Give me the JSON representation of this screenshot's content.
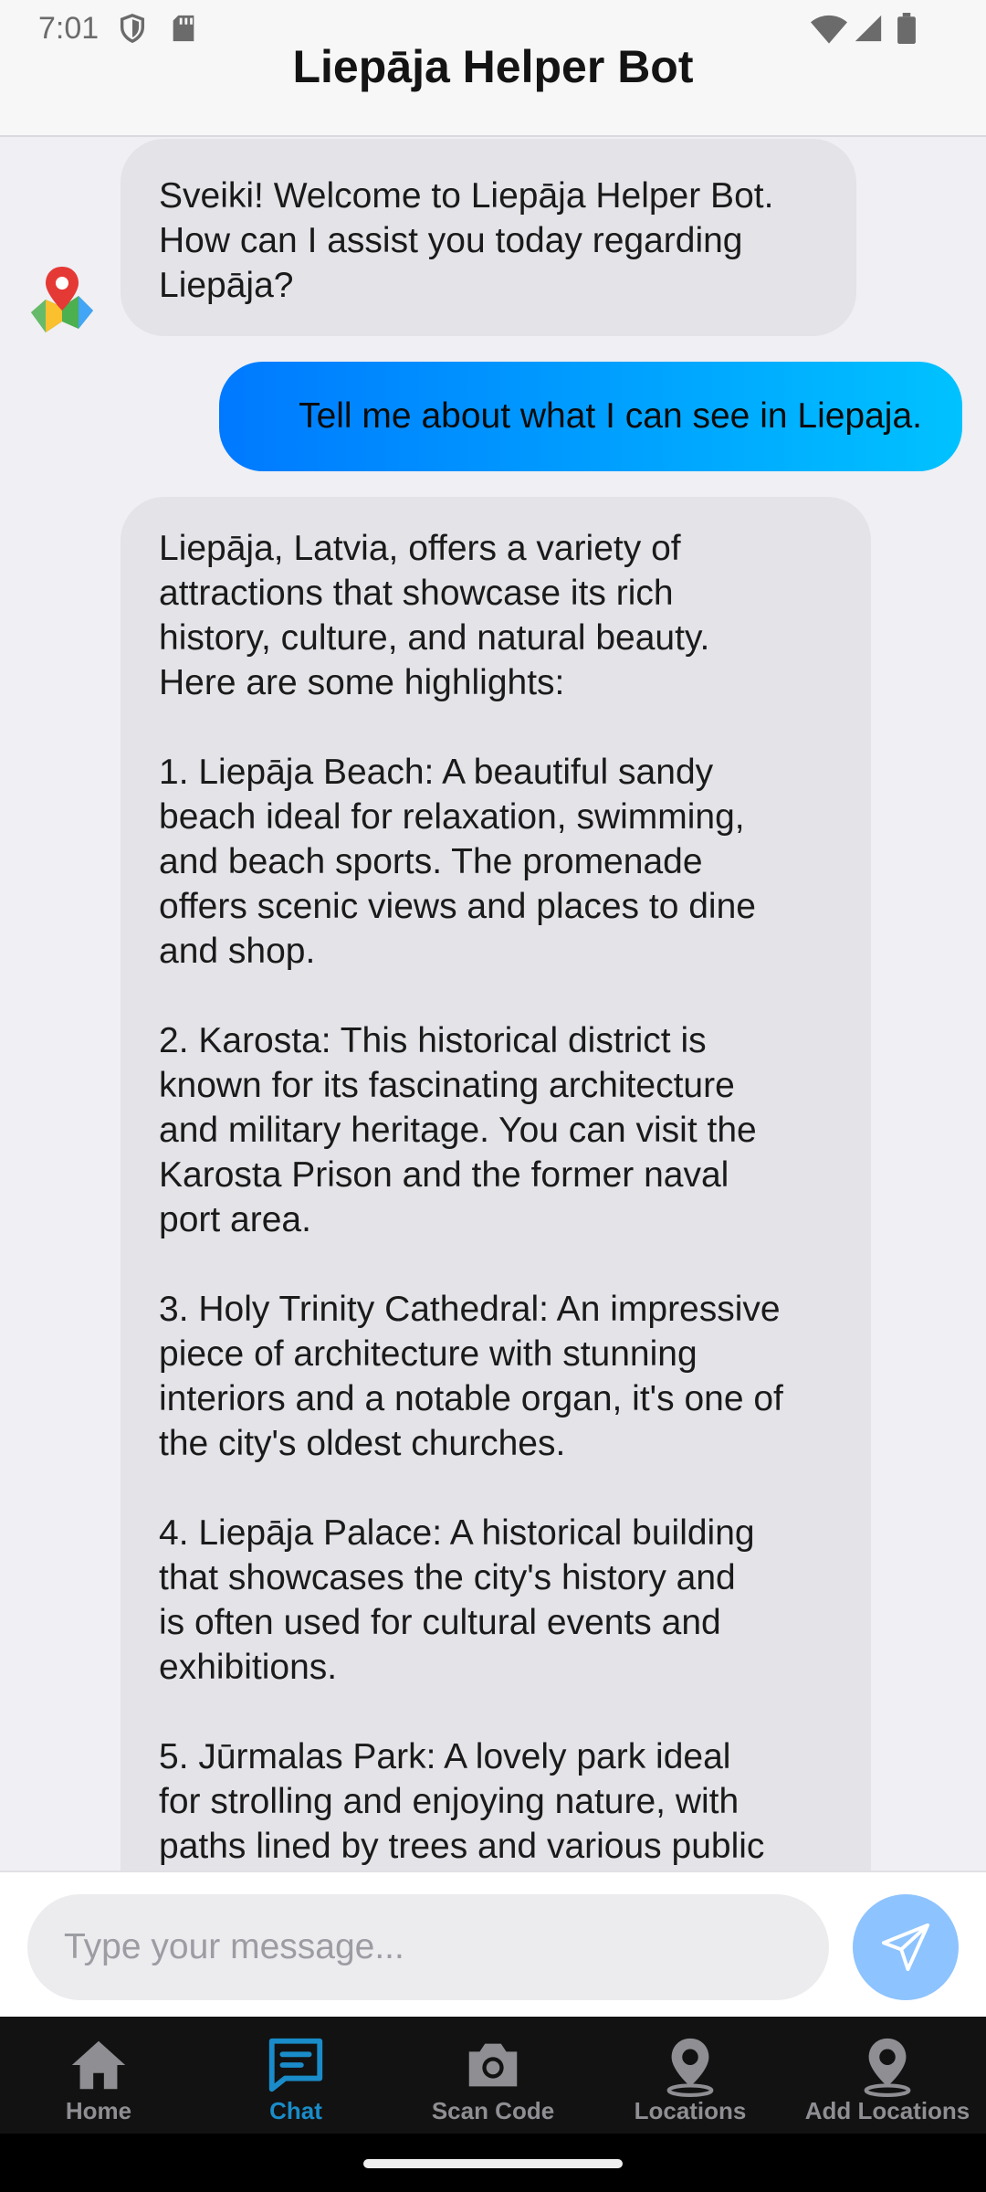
{
  "status_bar": {
    "time": "7:01"
  },
  "header": {
    "title": "Liepāja Helper Bot"
  },
  "messages": {
    "bot_1": "Sveiki! Welcome to Liepāja Helper Bot.\nHow can I assist you today regarding\nLiepāja?",
    "user_1": "Tell me about what I can see in Liepaja.",
    "bot_2": "Liepāja, Latvia, offers a variety of\nattractions that showcase its rich\nhistory, culture, and natural beauty.\nHere are some highlights:\n\n1. Liepāja Beach: A beautiful sandy\nbeach ideal for relaxation, swimming,\nand beach sports. The promenade\noffers scenic views and places to dine\nand shop.\n\n2. Karosta: This historical district is\nknown for its fascinating architecture\nand military heritage. You can visit the\nKarosta Prison and the former naval\nport area.\n\n3. Holy Trinity Cathedral: An impressive\npiece of architecture with stunning\ninteriors and a notable organ, it's one of\nthe city's oldest churches.\n\n4. Liepāja Palace: A historical building\nthat showcases the city's history and\nis often used for cultural events and\nexhibitions.\n\n5. Jūrmalas Park: A lovely park ideal\nfor strolling and enjoying nature, with\npaths lined by trees and various public"
  },
  "input": {
    "placeholder": "Type your message...",
    "value": ""
  },
  "nav": {
    "items": [
      {
        "label": "Home",
        "icon": "home-icon"
      },
      {
        "label": "Chat",
        "icon": "chat-icon"
      },
      {
        "label": "Scan Code",
        "icon": "camera-icon"
      },
      {
        "label": "Locations",
        "icon": "location-pin-icon"
      },
      {
        "label": "Add Locations",
        "icon": "location-pin-icon"
      }
    ],
    "active": "Chat"
  },
  "colors": {
    "accent": "#1a8cc9",
    "user_bubble_start": "#0079ff",
    "user_bubble_end": "#00c2ff",
    "bot_bubble": "#e3e3e8",
    "send_button": "#8dc3ff"
  }
}
